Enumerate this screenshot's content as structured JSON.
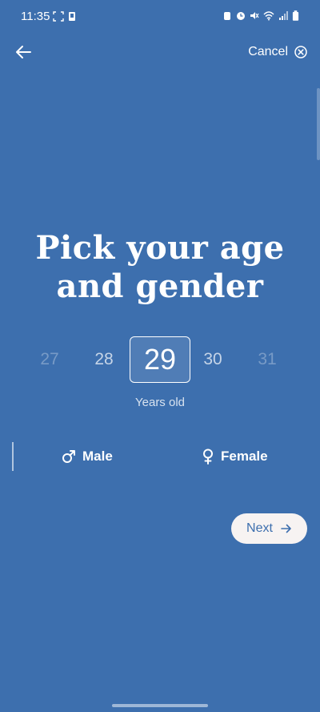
{
  "status_bar": {
    "time": "11:35"
  },
  "nav": {
    "cancel_label": "Cancel"
  },
  "title": {
    "line1": "Pick your age",
    "line2": "and gender"
  },
  "age_picker": {
    "values": [
      "27",
      "28",
      "29",
      "30",
      "31"
    ],
    "selected": "29",
    "caption": "Years old"
  },
  "gender": {
    "male_label": "Male",
    "female_label": "Female"
  },
  "actions": {
    "next_label": "Next"
  },
  "colors": {
    "background": "#3D6FAE",
    "button_bg": "#F7F3F2",
    "accent": "#3D6FAE"
  },
  "icons": {
    "back": "arrow-left-icon",
    "cancel": "close-circle-icon",
    "male": "male-symbol-icon",
    "female": "female-symbol-icon",
    "next": "arrow-right-icon"
  }
}
